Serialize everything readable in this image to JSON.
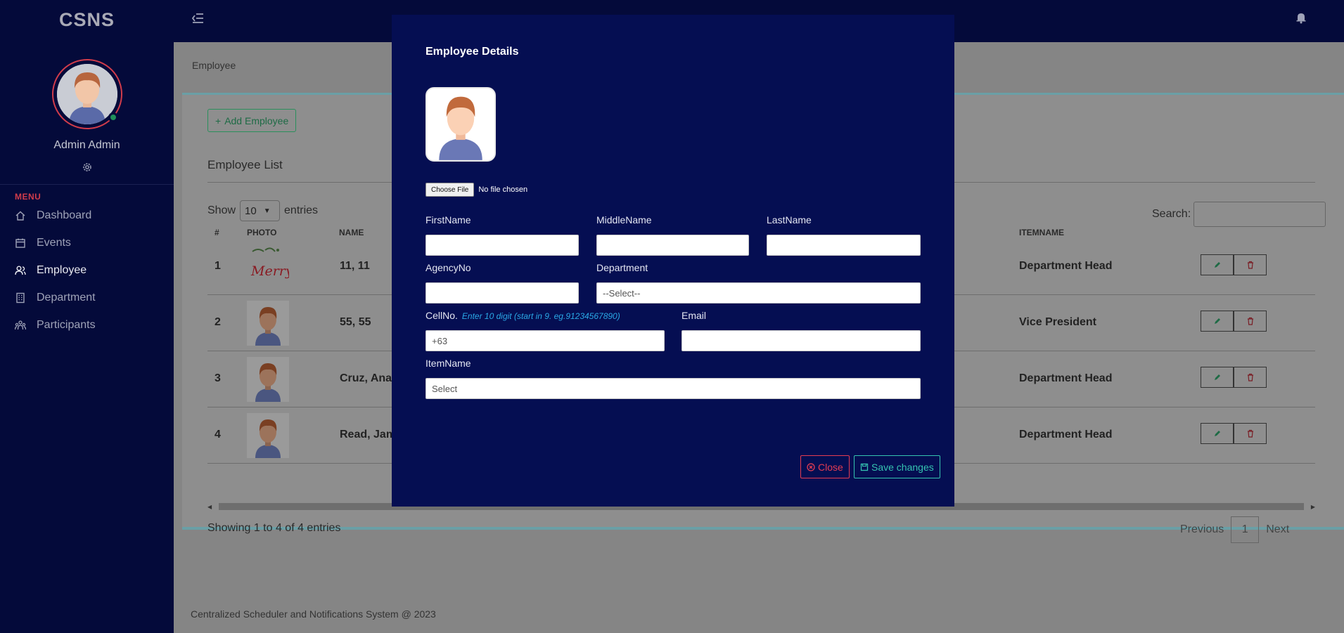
{
  "app": {
    "brand": "CSNS"
  },
  "sidebar": {
    "user_name": "Admin Admin",
    "menu_label": "MENU",
    "items": [
      {
        "label": "Dashboard",
        "icon": "home-icon"
      },
      {
        "label": "Events",
        "icon": "calendar-icon"
      },
      {
        "label": "Employee",
        "icon": "users-icon"
      },
      {
        "label": "Department",
        "icon": "building-icon"
      },
      {
        "label": "Participants",
        "icon": "participants-icon"
      }
    ]
  },
  "page": {
    "breadcrumb": "Employee",
    "add_button": "Add Employee",
    "list_title": "Employee List",
    "show_label": "Show",
    "show_value": "10",
    "entries_label": "entries",
    "search_label": "Search:",
    "columns": {
      "num": "#",
      "photo": "PHOTO",
      "name": "NAME",
      "itemname": "ITEMNAME"
    },
    "rows": [
      {
        "num": "1",
        "name": "11, 11",
        "itemname": "Department Head",
        "photo_text": "Merry"
      },
      {
        "num": "2",
        "name": "55, 55",
        "itemname": "Vice President"
      },
      {
        "num": "3",
        "name": "Cruz, Ana",
        "itemname": "Department Head"
      },
      {
        "num": "4",
        "name": "Read, Jam",
        "itemname": "Department Head"
      }
    ],
    "info": "Showing 1 to 4 of 4 entries",
    "pager": {
      "previous": "Previous",
      "page": "1",
      "next": "Next"
    },
    "footer": "Centralized Scheduler and Notifications System @ 2023"
  },
  "modal": {
    "title": "Employee Details",
    "file_button": "Choose File",
    "file_status": "No file chosen",
    "labels": {
      "first": "FirstName",
      "middle": "MiddleName",
      "last": "LastName",
      "agency": "AgencyNo",
      "department": "Department",
      "cell": "CellNo.",
      "cell_hint": "Enter 10 digit (start in 9. eg.91234567890)",
      "email": "Email",
      "itemname": "ItemName"
    },
    "values": {
      "department": "--Select--",
      "cell": "+63",
      "itemname": "Select"
    },
    "close_button": "Close",
    "save_button": "Save changes"
  },
  "colors": {
    "sidebar": "#040a3a",
    "modal": "#050e52",
    "accent_red": "#e43c52",
    "accent_teal": "#35c3b0"
  }
}
